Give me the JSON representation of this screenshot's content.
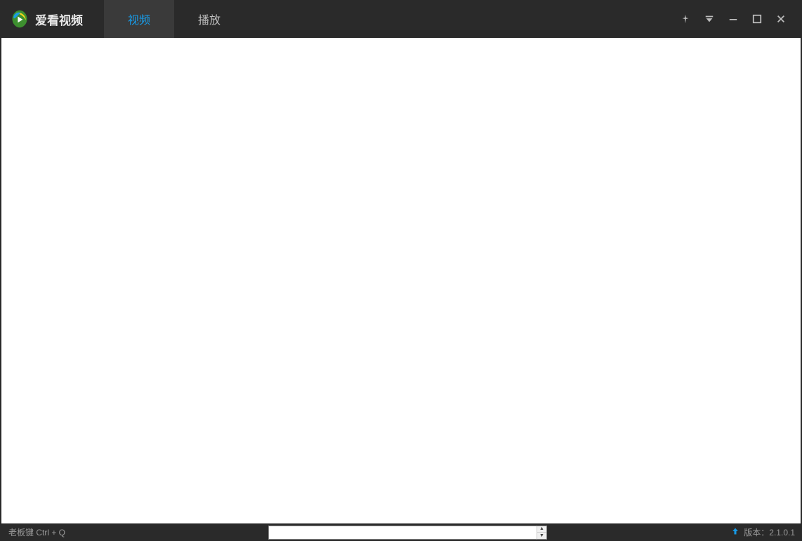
{
  "app": {
    "title": "爱看视频"
  },
  "tabs": [
    {
      "label": "视频",
      "active": true
    },
    {
      "label": "播放",
      "active": false
    }
  ],
  "statusbar": {
    "boss_key": "老板键 Ctrl + Q",
    "input_value": "",
    "version_label": "版本：2.1.0.1"
  }
}
